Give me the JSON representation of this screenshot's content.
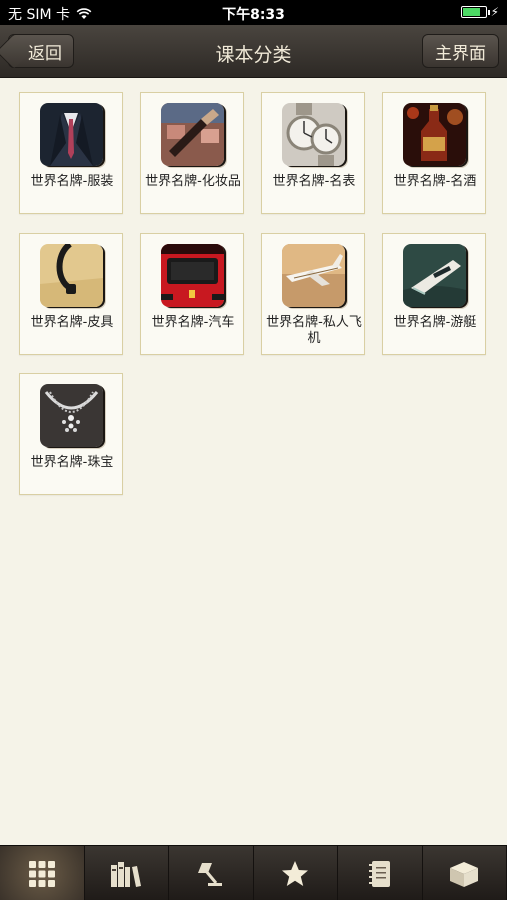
{
  "status_bar": {
    "carrier": "无 SIM 卡",
    "time": "下午8:33"
  },
  "nav": {
    "back_label": "返回",
    "title": "课本分类",
    "home_label": "主界面"
  },
  "categories": [
    {
      "label": "世界名牌-服装",
      "icon": "suit-icon"
    },
    {
      "label": "世界名牌-化妆品",
      "icon": "makeup-brush-icon"
    },
    {
      "label": "世界名牌-名表",
      "icon": "watch-icon"
    },
    {
      "label": "世界名牌-名酒",
      "icon": "liquor-icon"
    },
    {
      "label": "世界名牌-皮具",
      "icon": "leather-bag-icon"
    },
    {
      "label": "世界名牌-汽车",
      "icon": "car-icon"
    },
    {
      "label": "世界名牌-私人飞机",
      "icon": "private-jet-icon"
    },
    {
      "label": "世界名牌-游艇",
      "icon": "yacht-icon"
    },
    {
      "label": "世界名牌-珠宝",
      "icon": "jewelry-icon"
    }
  ],
  "tabs": [
    {
      "icon": "grid-icon",
      "active": true
    },
    {
      "icon": "bookshelf-icon",
      "active": false
    },
    {
      "icon": "lamp-icon",
      "active": false
    },
    {
      "icon": "star-icon",
      "active": false
    },
    {
      "icon": "notebook-icon",
      "active": false
    },
    {
      "icon": "box-icon",
      "active": false
    }
  ]
}
